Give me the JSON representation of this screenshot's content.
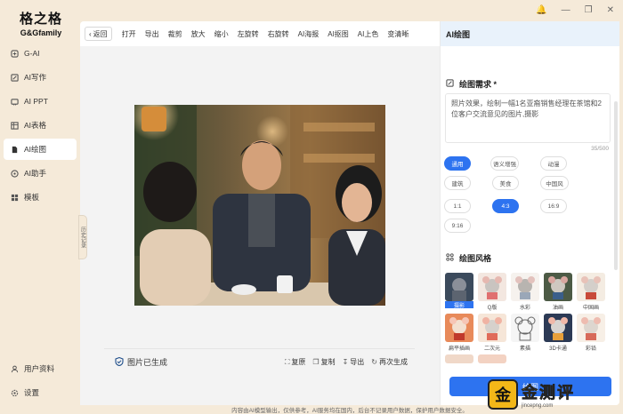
{
  "app": {
    "name_cn": "格之格",
    "name_en": "G&Gfamily"
  },
  "sidebar": {
    "items": [
      {
        "label": "G-AI",
        "icon": "g-ai-icon"
      },
      {
        "label": "AI写作",
        "icon": "pen-icon"
      },
      {
        "label": "AI PPT",
        "icon": "slides-icon"
      },
      {
        "label": "AI表格",
        "icon": "table-icon"
      },
      {
        "label": "AI绘图",
        "icon": "paint-icon",
        "active": true
      },
      {
        "label": "AI助手",
        "icon": "assistant-icon"
      },
      {
        "label": "模板",
        "icon": "template-icon"
      }
    ],
    "bottom": [
      {
        "label": "用户资料",
        "icon": "user-icon"
      },
      {
        "label": "设置",
        "icon": "gear-icon"
      }
    ]
  },
  "toolbar": {
    "back": "返回",
    "tools": [
      "打开",
      "导出",
      "裁剪",
      "放大",
      "缩小",
      "左旋转",
      "右旋转",
      "AI海报",
      "AI抠图",
      "AI上色",
      "变清晰"
    ]
  },
  "canvas": {
    "history_tab": "历史记录",
    "status": "图片已生成",
    "actions": [
      "复原",
      "复制",
      "导出",
      "再次生成"
    ]
  },
  "right_panel": {
    "header": "AI绘图",
    "demand_title": "绘图需求 *",
    "prompt": "照片效果，绘制一幅1名亚裔销售经理在茶馆和2位客户交流意见的图片,摄影",
    "counter": "35/500",
    "mode_chips": [
      "通用",
      "语义增强",
      "动漫",
      "建筑",
      "美食",
      "中国风"
    ],
    "ratio_chips": [
      "1:1",
      "4:3",
      "16:9",
      "9:16"
    ],
    "selected_mode": "通用",
    "selected_ratio": "4:3",
    "style_title": "绘图风格",
    "styles": [
      "摄影",
      "Q版",
      "水彩",
      "油画",
      "中国画",
      "扁平插画",
      "二次元",
      "素描",
      "3D卡通",
      "彩铅"
    ],
    "selected_style": "摄影",
    "generate_button": "绘图"
  },
  "footer": "内容由AI模型输出，仅供参考，AI服务均在国内，后台不记录用户数据，保护用户数据安全。",
  "watermark": {
    "badge": "金",
    "text": "金测评",
    "url": "jincepng.com"
  },
  "colors": {
    "accent": "#2d73f0",
    "sidebar_bg": "#f5ead9"
  }
}
